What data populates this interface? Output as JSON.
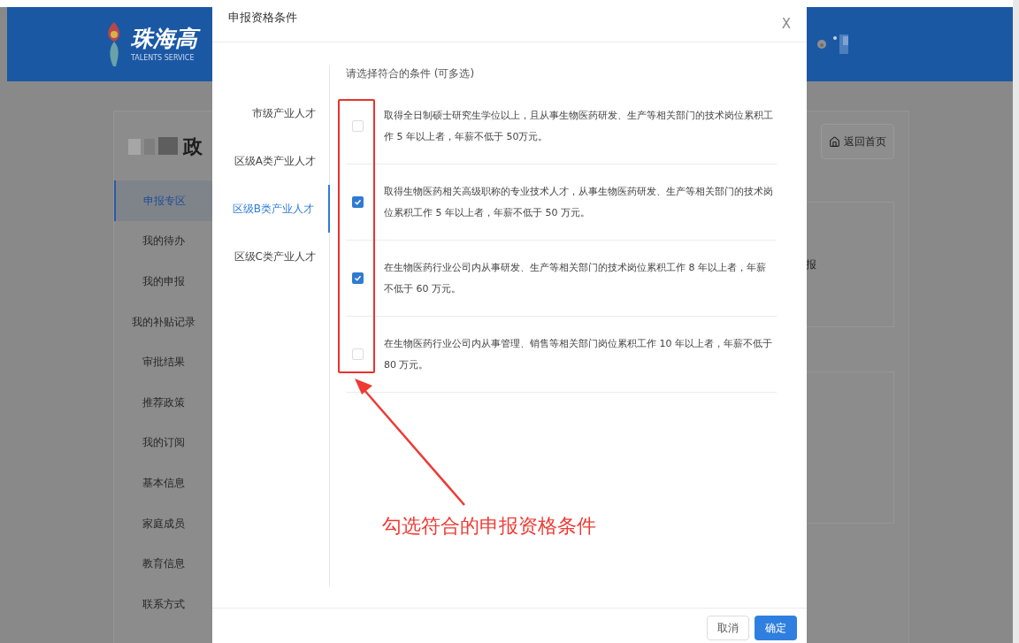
{
  "header": {
    "logo_title": "珠海高",
    "logo_subtitle": "TALENTS SERVICE"
  },
  "page": {
    "title": "政",
    "home_button": "返回首页",
    "side_text": "报"
  },
  "sidebar": {
    "items": [
      {
        "label": "申报专区",
        "selected": true
      },
      {
        "label": "我的待办",
        "selected": false
      },
      {
        "label": "我的申报",
        "selected": false
      },
      {
        "label": "我的补贴记录",
        "selected": false
      },
      {
        "label": "审批结果",
        "selected": false
      },
      {
        "label": "推荐政策",
        "selected": false
      },
      {
        "label": "我的订阅",
        "selected": false
      },
      {
        "label": "基本信息",
        "selected": false
      },
      {
        "label": "家庭成员",
        "selected": false
      },
      {
        "label": "教育信息",
        "selected": false
      },
      {
        "label": "联系方式",
        "selected": false
      }
    ]
  },
  "dialog": {
    "title": "申报资格条件",
    "close": "X",
    "tabs": [
      {
        "label": "市级产业人才",
        "selected": false
      },
      {
        "label": "区级A类产业人才",
        "selected": false
      },
      {
        "label": "区级B类产业人才",
        "selected": true
      },
      {
        "label": "区级C类产业人才",
        "selected": false
      }
    ],
    "prompt": "请选择符合的条件 (可多选)",
    "criteria": [
      {
        "text": "取得全日制硕士研究生学位以上，且从事生物医药研发、生产等相关部门的技术岗位累积工作 5 年以上者，年薪不低于 50万元。",
        "checked": false
      },
      {
        "text": "取得生物医药相关高级职称的专业技术人才，从事生物医药研发、生产等相关部门的技术岗位累积工作 5 年以上者，年薪不低于 50 万元。",
        "checked": true
      },
      {
        "text": "在生物医药行业公司内从事研发、生产等相关部门的技术岗位累积工作 8 年以上者，年薪不低于 60 万元。",
        "checked": true
      },
      {
        "text": "在生物医药行业公司内从事管理、销售等相关部门岗位累积工作 10 年以上者，年薪不低于 80 万元。",
        "checked": false
      }
    ],
    "buttons": [
      {
        "label": "取消",
        "kind": "secondary"
      },
      {
        "label": "确定",
        "kind": "primary"
      }
    ]
  },
  "annotation": {
    "text": "勾选符合的申报资格条件"
  }
}
